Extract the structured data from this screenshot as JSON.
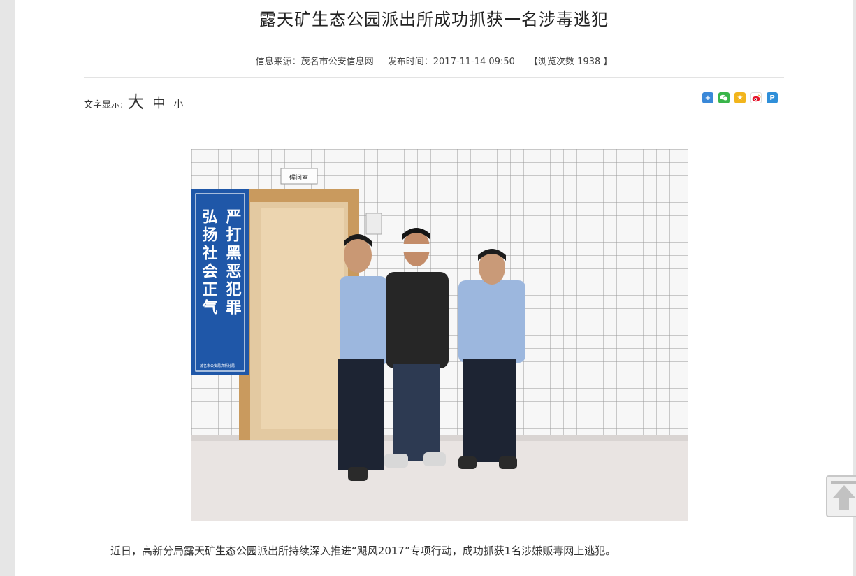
{
  "article": {
    "title": "露天矿生态公园派出所成功抓获一名涉毒逃犯",
    "source": "信息来源：茂名市公安信息网",
    "publish_time": "发布时间：2017-11-14 09:50",
    "views": "【浏览次数 1938 】"
  },
  "font_size": {
    "label": "文字显示:",
    "large": "大",
    "medium": "中",
    "small": "小"
  },
  "share_icons": [
    "plus-icon",
    "wechat-icon",
    "qzone-icon",
    "weibo-icon",
    "pengyou-icon"
  ],
  "photo": {
    "room_sign": "候问室",
    "banner_left": "弘扬社会正气",
    "banner_right": "严打黑恶犯罪",
    "banner_footer": "茂名市公安局高新分局"
  },
  "body": {
    "paragraph": "近日，高新分局露天矿生态公园派出所持续深入推进“飓风2017”专项行动，成功抓获1名涉嫌贩毒网上逃犯。"
  },
  "back_to_top": "back-to-top-icon"
}
